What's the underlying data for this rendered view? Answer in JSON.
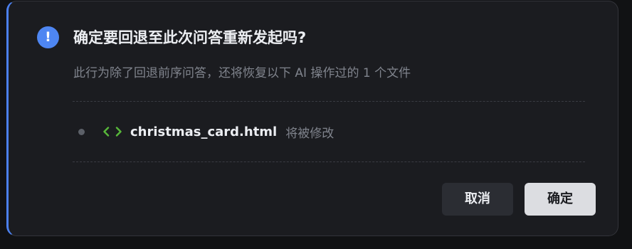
{
  "dialog": {
    "title": "确定要回退至此次问答重新发起吗?",
    "description": "此行为除了回退前序问答，还将恢复以下 AI 操作过的 1 个文件",
    "alert_icon": "info-circle-icon",
    "alert_glyph": "!",
    "files": [
      {
        "name": "christmas_card.html",
        "status": "将被修改",
        "icon": "code-brackets-icon"
      }
    ],
    "buttons": {
      "cancel_label": "取消",
      "confirm_label": "确定"
    }
  },
  "colors": {
    "background": "#111214",
    "dialog_bg": "#1b1c20",
    "accent": "#4b80ee",
    "code_icon": "#58b83a",
    "text_primary": "#eceef2",
    "text_secondary": "#80848d"
  }
}
